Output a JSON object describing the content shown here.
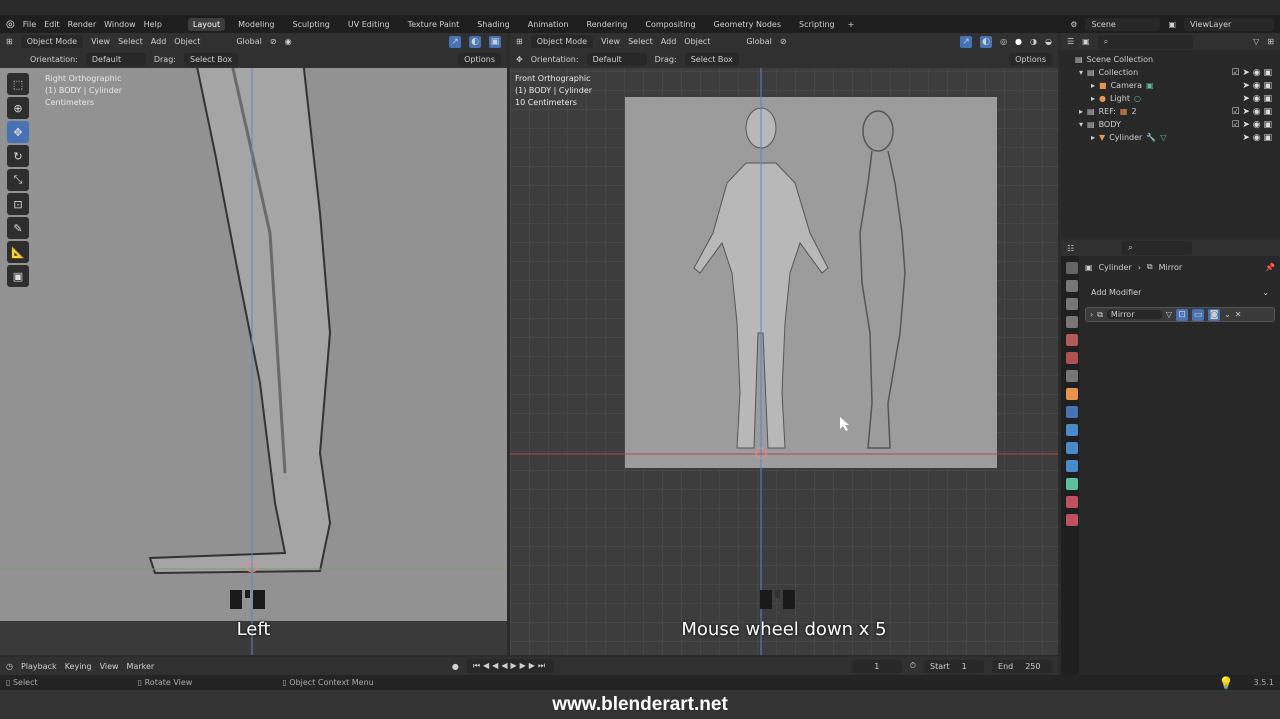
{
  "menu": {
    "items": [
      "File",
      "Edit",
      "Render",
      "Window",
      "Help"
    ],
    "workspaces": [
      "Layout",
      "Modeling",
      "Sculpting",
      "UV Editing",
      "Texture Paint",
      "Shading",
      "Animation",
      "Rendering",
      "Compositing",
      "Geometry Nodes",
      "Scripting"
    ],
    "add": "+",
    "scene": "Scene",
    "view_layer": "ViewLayer"
  },
  "viewport_header": {
    "mode": "Object Mode",
    "menus": [
      "View",
      "Select",
      "Add",
      "Object"
    ],
    "transform": "Global",
    "orientation_label": "Orientation:",
    "orientation": "Default",
    "drag_label": "Drag:",
    "drag": "Select Box",
    "options": "Options"
  },
  "left_view": {
    "title": "Right Orthographic",
    "object": "(1) BODY | Cylinder",
    "units": "Centimeters",
    "caption": "Left"
  },
  "right_view": {
    "title": "Front Orthographic",
    "object": "(1) BODY | Cylinder",
    "units": "10 Centimeters",
    "caption": "Mouse wheel down x 5"
  },
  "outliner": {
    "root": "Scene Collection",
    "items": [
      {
        "name": "Collection",
        "depth": 0
      },
      {
        "name": "Camera",
        "depth": 1
      },
      {
        "name": "Light",
        "depth": 1
      },
      {
        "name": "REF:",
        "depth": 0,
        "badge": "2"
      },
      {
        "name": "BODY",
        "depth": 0
      },
      {
        "name": "Cylinder",
        "depth": 1
      }
    ]
  },
  "properties": {
    "object": "Cylinder",
    "modifier": "Mirror",
    "add_modifier": "Add Modifier",
    "modifier_name": "Mirror"
  },
  "timeline": {
    "menus": [
      "Playback",
      "Keying",
      "View",
      "Marker"
    ],
    "frame": "1",
    "start_label": "Start",
    "start": "1",
    "end_label": "End",
    "end": "250"
  },
  "status": {
    "items": [
      "Select",
      "Rotate View",
      "Object Context Menu"
    ],
    "version": "3.5.1"
  },
  "watermark": "www.blenderart.net",
  "colors": {
    "accent": "#4772b3",
    "x_axis": "#c0404a",
    "y_axis": "#5a86c8"
  }
}
